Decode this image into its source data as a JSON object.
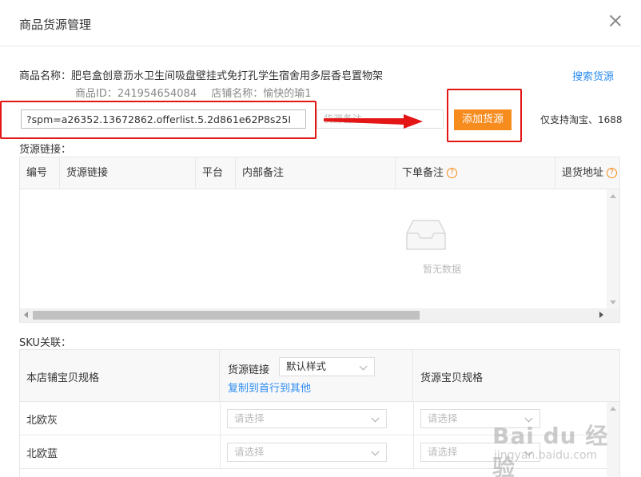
{
  "dialog": {
    "title": "商品货源管理"
  },
  "product": {
    "name_line": "商品名称：肥皂盒创意沥水卫生间吸盘壁挂式免打孔学生宿舍用多层香皂置物架",
    "id_text": "商品ID：241954654084",
    "shop_text": "店铺名称：愉快的瑜1"
  },
  "search_link": "搜索货源",
  "source_input": {
    "value": "?spm=a26352.13672862.offerlist.5.2d861e62P8s25I"
  },
  "note_input": {
    "placeholder": "货源备注"
  },
  "add_button": "添加货源",
  "support_text": "仅支持淘宝、1688",
  "links_section": {
    "label": "货源链接：",
    "columns": [
      "编号",
      "货源链接",
      "平台",
      "内部备注",
      "下单备注",
      "退货地址"
    ],
    "empty_text": "暂无数据",
    "rows": []
  },
  "sku_section": {
    "label": "SKU关联：",
    "col_store_spec": "本店铺宝贝规格",
    "col_source_link": "货源链接",
    "style_select": "默认样式",
    "copy_link": "复制到首行到其他",
    "col_source_spec": "货源宝贝规格",
    "rows": [
      {
        "name": "北欧灰",
        "select_placeholder": "请选择",
        "spec_placeholder": "请选择"
      },
      {
        "name": "北欧蓝",
        "select_placeholder": "请选择",
        "spec_placeholder": "请选择"
      }
    ]
  },
  "watermark": {
    "brand": "Bai du 经验",
    "url": "jingyan.baidu.com"
  },
  "colors": {
    "accent": "#f68b1e",
    "link": "#2d8cf0",
    "annotation": "#e31515"
  }
}
